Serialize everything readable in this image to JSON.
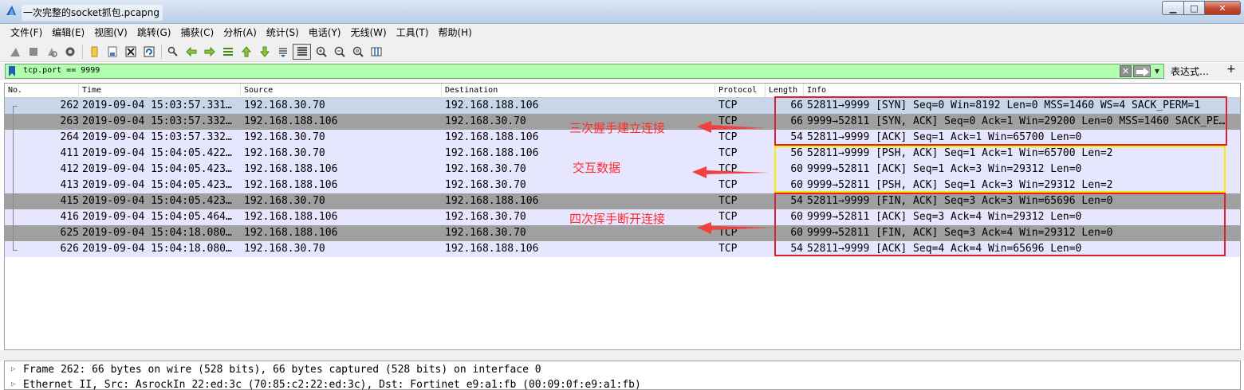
{
  "window": {
    "title": "一次完整的socket抓包.pcapng",
    "min_label": "▁",
    "max_label": "□",
    "close_label": "✕"
  },
  "menu": [
    {
      "label": "文件(F)"
    },
    {
      "label": "编辑(E)"
    },
    {
      "label": "视图(V)"
    },
    {
      "label": "跳转(G)"
    },
    {
      "label": "捕获(C)"
    },
    {
      "label": "分析(A)"
    },
    {
      "label": "统计(S)"
    },
    {
      "label": "电话(Y)"
    },
    {
      "label": "无线(W)"
    },
    {
      "label": "工具(T)"
    },
    {
      "label": "帮助(H)"
    }
  ],
  "toolbar_icons": [
    "shark-fin-start-icon",
    "stop-icon",
    "restart-icon",
    "options-gear-icon",
    "open-folder-icon",
    "save-file-icon",
    "close-file-icon",
    "reload-icon",
    "find-packet-icon",
    "go-back-icon",
    "go-forward-icon",
    "go-to-packet-icon",
    "first-packet-icon",
    "last-packet-icon",
    "autoscroll-icon",
    "colorize-icon",
    "zoom-in-icon",
    "zoom-out-icon",
    "zoom-normal-icon",
    "resize-columns-icon"
  ],
  "filter": {
    "value": "tcp.port == 9999",
    "expression_label": "表达式…",
    "plus_label": "+",
    "color": "#afffaf"
  },
  "columns": {
    "no": "No.",
    "time": "Time",
    "source": "Source",
    "destination": "Destination",
    "protocol": "Protocol",
    "length": "Length",
    "info": "Info"
  },
  "packets": [
    {
      "no": "262",
      "time": "2019-09-04 15:03:57.331…",
      "src": "192.168.30.70",
      "dst": "192.168.188.106",
      "proto": "TCP",
      "len": "66",
      "info": "52811→9999 [SYN] Seq=0 Win=8192 Len=0 MSS=1460 WS=4 SACK_PERM=1",
      "style": "sel"
    },
    {
      "no": "263",
      "time": "2019-09-04 15:03:57.332…",
      "src": "192.168.188.106",
      "dst": "192.168.30.70",
      "proto": "TCP",
      "len": "66",
      "info": "9999→52811 [SYN, ACK] Seq=0 Ack=1 Win=29200 Len=0 MSS=1460 SACK_PE…",
      "style": "dark"
    },
    {
      "no": "264",
      "time": "2019-09-04 15:03:57.332…",
      "src": "192.168.30.70",
      "dst": "192.168.188.106",
      "proto": "TCP",
      "len": "54",
      "info": "52811→9999 [ACK] Seq=1 Ack=1 Win=65700 Len=0",
      "style": "light"
    },
    {
      "no": "411",
      "time": "2019-09-04 15:04:05.422…",
      "src": "192.168.30.70",
      "dst": "192.168.188.106",
      "proto": "TCP",
      "len": "56",
      "info": "52811→9999 [PSH, ACK] Seq=1 Ack=1 Win=65700 Len=2",
      "style": "light"
    },
    {
      "no": "412",
      "time": "2019-09-04 15:04:05.423…",
      "src": "192.168.188.106",
      "dst": "192.168.30.70",
      "proto": "TCP",
      "len": "60",
      "info": "9999→52811 [ACK] Seq=1 Ack=3 Win=29312 Len=0",
      "style": "light"
    },
    {
      "no": "413",
      "time": "2019-09-04 15:04:05.423…",
      "src": "192.168.188.106",
      "dst": "192.168.30.70",
      "proto": "TCP",
      "len": "60",
      "info": "9999→52811 [PSH, ACK] Seq=1 Ack=3 Win=29312 Len=2",
      "style": "light"
    },
    {
      "no": "415",
      "time": "2019-09-04 15:04:05.423…",
      "src": "192.168.30.70",
      "dst": "192.168.188.106",
      "proto": "TCP",
      "len": "54",
      "info": "52811→9999 [FIN, ACK] Seq=3 Ack=3 Win=65696 Len=0",
      "style": "dark"
    },
    {
      "no": "416",
      "time": "2019-09-04 15:04:05.464…",
      "src": "192.168.188.106",
      "dst": "192.168.30.70",
      "proto": "TCP",
      "len": "60",
      "info": "9999→52811 [ACK] Seq=3 Ack=4 Win=29312 Len=0",
      "style": "light"
    },
    {
      "no": "625",
      "time": "2019-09-04 15:04:18.080…",
      "src": "192.168.188.106",
      "dst": "192.168.30.70",
      "proto": "TCP",
      "len": "60",
      "info": "9999→52811 [FIN, ACK] Seq=3 Ack=4 Win=29312 Len=0",
      "style": "dark"
    },
    {
      "no": "626",
      "time": "2019-09-04 15:04:18.080…",
      "src": "192.168.30.70",
      "dst": "192.168.188.106",
      "proto": "TCP",
      "len": "54",
      "info": "52811→9999 [ACK] Seq=4 Ack=4 Win=65696 Len=0",
      "style": "light"
    }
  ],
  "annotations": {
    "handshake": "三次握手建立连接",
    "data": "交互数据",
    "teardown": "四次挥手断开连接",
    "red": "#e02030",
    "yellow": "#ffea00"
  },
  "details": [
    {
      "text": "Frame 262: 66 bytes on wire (528 bits), 66 bytes captured (528 bits) on interface 0"
    },
    {
      "text": "Ethernet II, Src: AsrockIn_22:ed:3c (70:85:c2:22:ed:3c), Dst: Fortinet_e9:a1:fb (00:09:0f:e9:a1:fb)"
    }
  ]
}
